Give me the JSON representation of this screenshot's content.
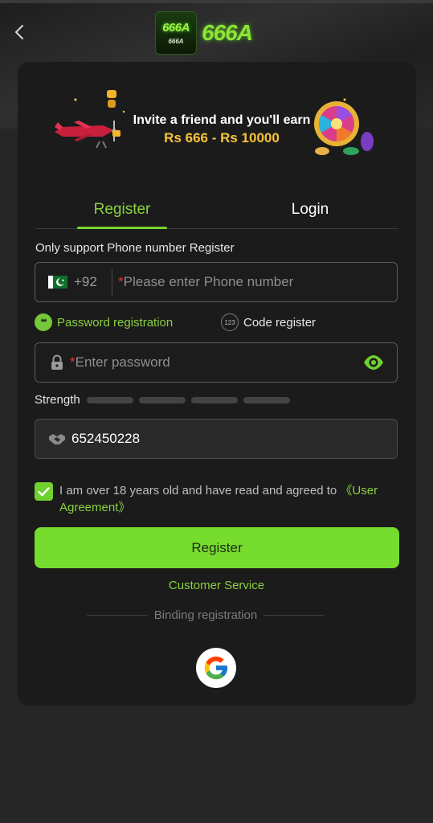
{
  "header": {
    "logo_badge_big": "666A",
    "logo_badge_small": "666A",
    "logo_text": "666A"
  },
  "banner": {
    "line1": "Invite a friend and you'll earn",
    "line2": "Rs 666 - Rs 10000"
  },
  "tabs": [
    {
      "label": "Register",
      "active": true
    },
    {
      "label": "Login",
      "active": false
    }
  ],
  "form": {
    "hint": "Only support Phone number Register",
    "phone": {
      "country_code": "+92",
      "required_mark": "*",
      "placeholder": "Please enter Phone number"
    },
    "mode_options": [
      {
        "label": "Password registration",
        "selected": true,
        "icon_text": "**"
      },
      {
        "label": "Code register",
        "selected": false,
        "icon_text": "123"
      }
    ],
    "password": {
      "required_mark": "*",
      "placeholder": "Enter password"
    },
    "strength": {
      "label": "Strength",
      "level": 0,
      "segments": 4
    },
    "invite_code": {
      "value": "652450228"
    },
    "agreement": {
      "checked": true,
      "text": "I am over 18 years old and have read and agreed to ",
      "link": "《User Agreement》"
    },
    "submit_label": "Register"
  },
  "customer_service": "Customer Service",
  "binding_label": "Binding registration",
  "colors": {
    "accent": "#76dc2e",
    "background": "#262626",
    "card": "#1b1b1b",
    "required": "#e23b3b"
  },
  "icons": {
    "back": "chevron-left-icon",
    "flag": "pakistan-flag-icon",
    "lock": "lock-icon",
    "eye": "eye-icon",
    "invite": "handshake-icon",
    "check": "check-icon",
    "google": "google-icon"
  }
}
